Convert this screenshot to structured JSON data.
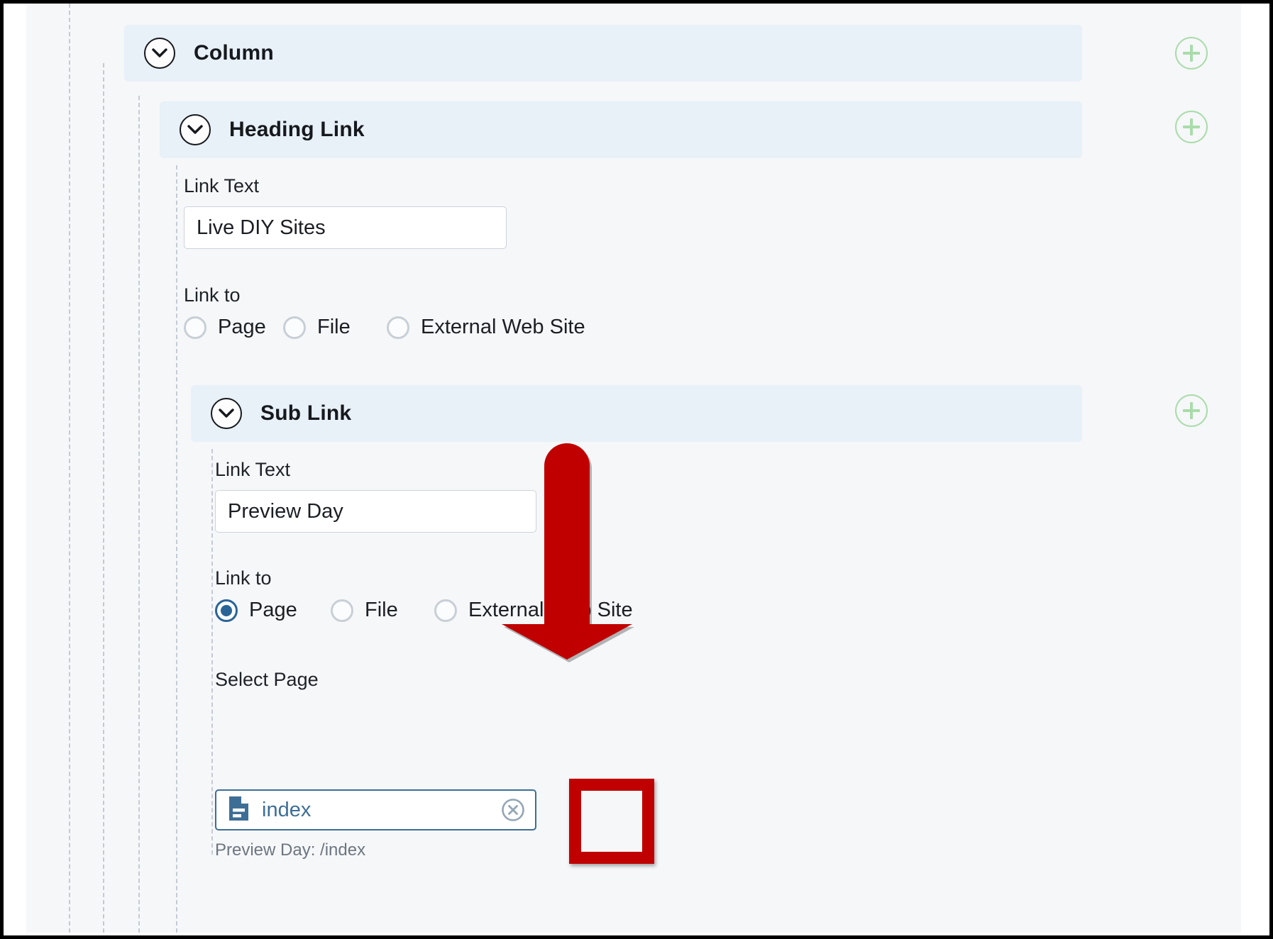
{
  "sections": [
    {
      "name": "column",
      "title": "Column",
      "toggle_icon": "chevron-down-icon",
      "add_icon": "plus-circle-icon"
    },
    {
      "name": "heading-link",
      "title": "Heading Link",
      "toggle_icon": "chevron-down-icon",
      "add_icon": "plus-circle-icon",
      "fields": {
        "link_text_label": "Link Text",
        "link_text_value": "Live DIY Sites",
        "link_text_placeholder": "",
        "link_to_label": "Link to",
        "link_to_options": [
          {
            "label": "Page",
            "selected": false
          },
          {
            "label": "File",
            "selected": false
          },
          {
            "label": "External Web Site",
            "selected": false
          }
        ]
      }
    },
    {
      "name": "sub-link",
      "title": "Sub Link",
      "toggle_icon": "chevron-down-icon",
      "add_icon": "plus-circle-icon",
      "fields": {
        "link_text_label": "Link Text",
        "link_text_value": "Preview Day",
        "link_text_placeholder": "",
        "link_to_label": "Link to",
        "link_to_options": [
          {
            "label": "Page",
            "selected": true
          },
          {
            "label": "File",
            "selected": false
          },
          {
            "label": "External Web Site",
            "selected": false
          }
        ],
        "select_page_label": "Select Page",
        "select_page_value": "index",
        "select_page_icon": "document-icon",
        "clear_icon": "circle-x-icon",
        "helper_text": "Preview Day: /index"
      }
    }
  ],
  "annotations": {
    "arrow": {
      "name": "red-down-arrow",
      "color": "#c00000",
      "direction": "down"
    },
    "highlight_box": {
      "name": "red-highlight-box",
      "color": "#c00000",
      "target": "clear-icon"
    }
  },
  "colors": {
    "section_header_bg": "#e8f0f8",
    "canvas_bg": "#f6f7f9",
    "accent_blue": "#3d6e96",
    "add_green": "#a9dcaa",
    "annotation_red": "#c00000"
  }
}
